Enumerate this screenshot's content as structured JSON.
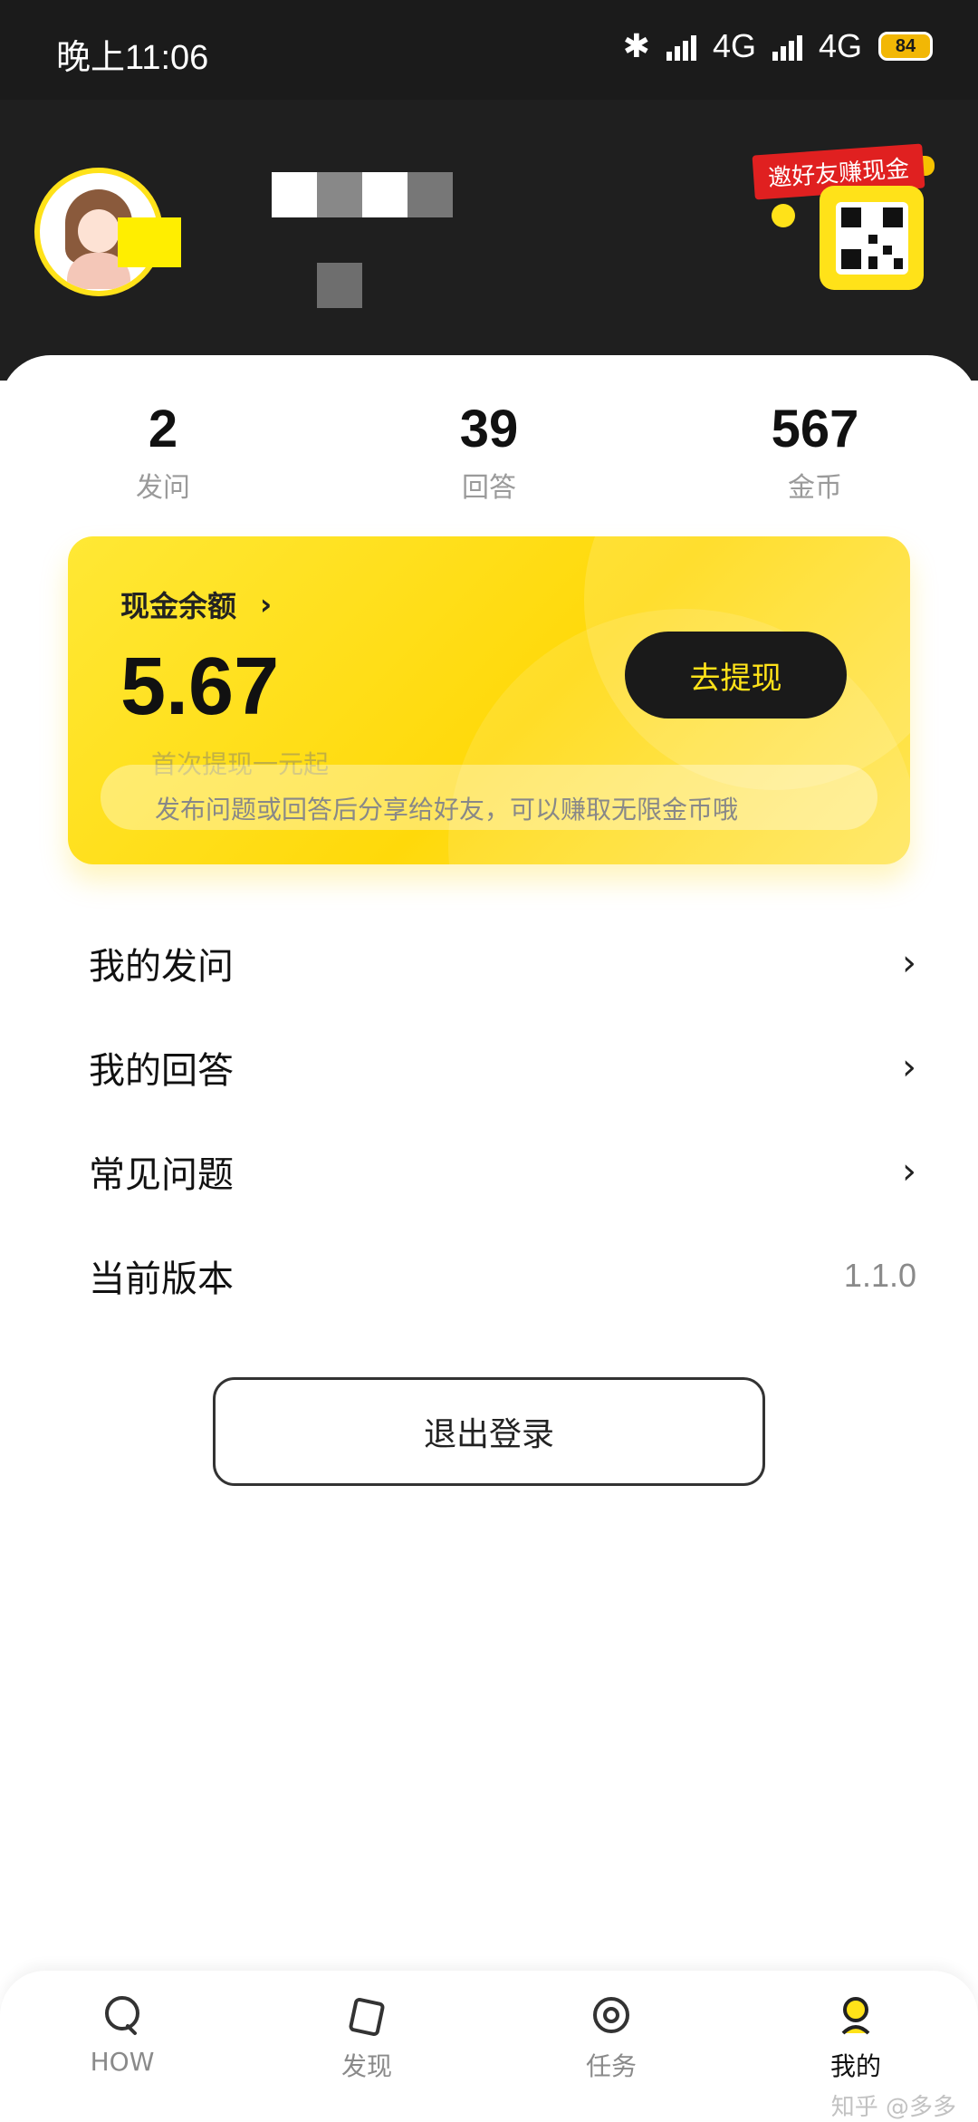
{
  "status_bar": {
    "time": "晚上11:06",
    "network1": "4G",
    "network2": "4G",
    "battery": "84"
  },
  "header": {
    "invite_label": "邀好友赚现金"
  },
  "stats": [
    {
      "value": "2",
      "label": "发问"
    },
    {
      "value": "39",
      "label": "回答"
    },
    {
      "value": "567",
      "label": "金币"
    }
  ],
  "balance": {
    "title": "现金余额",
    "chevron": "›",
    "amount": "5.67",
    "withdraw_label": "去提现",
    "tip1": "首次提现一元起",
    "tip2": "发布问题或回答后分享给好友，可以赚取无限金币哦"
  },
  "menu": [
    {
      "label": "我的发问",
      "chevron": "›"
    },
    {
      "label": "我的回答",
      "chevron": "›"
    },
    {
      "label": "常见问题",
      "chevron": "›"
    },
    {
      "label": "当前版本",
      "value": "1.1.0"
    }
  ],
  "logout_label": "退出登录",
  "bottom_nav": [
    {
      "label": "HOW",
      "icon": "chat-bubble-icon"
    },
    {
      "label": "发现",
      "icon": "cards-icon"
    },
    {
      "label": "任务",
      "icon": "target-icon"
    },
    {
      "label": "我的",
      "icon": "profile-icon",
      "active": true
    }
  ],
  "watermark": "知乎 @多多",
  "colors": {
    "accent_yellow": "#ffe219",
    "dark": "#1f1f1f",
    "invite_red": "#e02020"
  }
}
